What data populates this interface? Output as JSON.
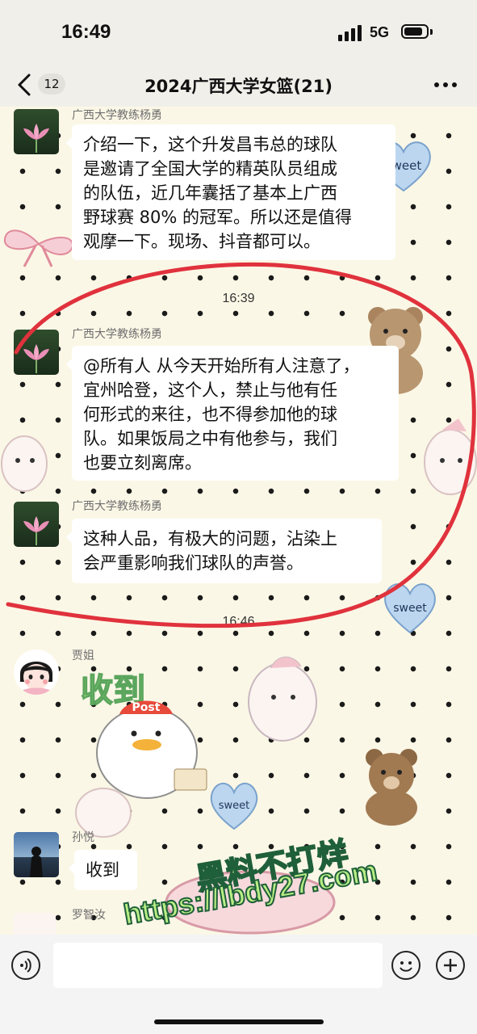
{
  "status_bar": {
    "time": "16:49",
    "network": "5G"
  },
  "nav": {
    "unread_count": "12",
    "title": "2024广西大学女篮(21)"
  },
  "messages": [
    {
      "sender": "广西大学教练杨勇",
      "lines": [
        "介绍一下，这个升发昌韦总的球队",
        "是邀请了全国大学的精英队员组成",
        "的队伍，近几年囊括了基本上广西",
        "野球赛 80% 的冠军。所以还是值得",
        "观摩一下。现场、抖音都可以。"
      ]
    },
    {
      "timestamp": "16:39"
    },
    {
      "sender": "广西大学教练杨勇",
      "lines": [
        "@所有人 从今天开始所有人注意了，",
        "宜州哈登，这个人，禁止与他有任",
        "何形式的来往，也不得参加他的球",
        "队。如果饭局之中有他参与，我们",
        "也要立刻离席。"
      ]
    },
    {
      "sender": "广西大学教练杨勇",
      "lines": [
        "这种人品，有极大的问题，沾染上",
        "会严重影响我们球队的声誉。"
      ]
    },
    {
      "timestamp": "16:46"
    },
    {
      "sender": "贾姐",
      "sticker_text": "收到",
      "sticker_badge": "Post"
    },
    {
      "sender": "孙悦",
      "lines": [
        "收到"
      ]
    },
    {
      "sender": "罗智汝"
    }
  ],
  "decor": {
    "sweet": "sweet"
  },
  "watermark": {
    "line1": "黑料不打烊",
    "line2": "https://lbdy27.com"
  },
  "colors": {
    "bubble": "#ffffff",
    "annotation_red": "#e0323d",
    "watermark_fill": "#b9ee85"
  }
}
